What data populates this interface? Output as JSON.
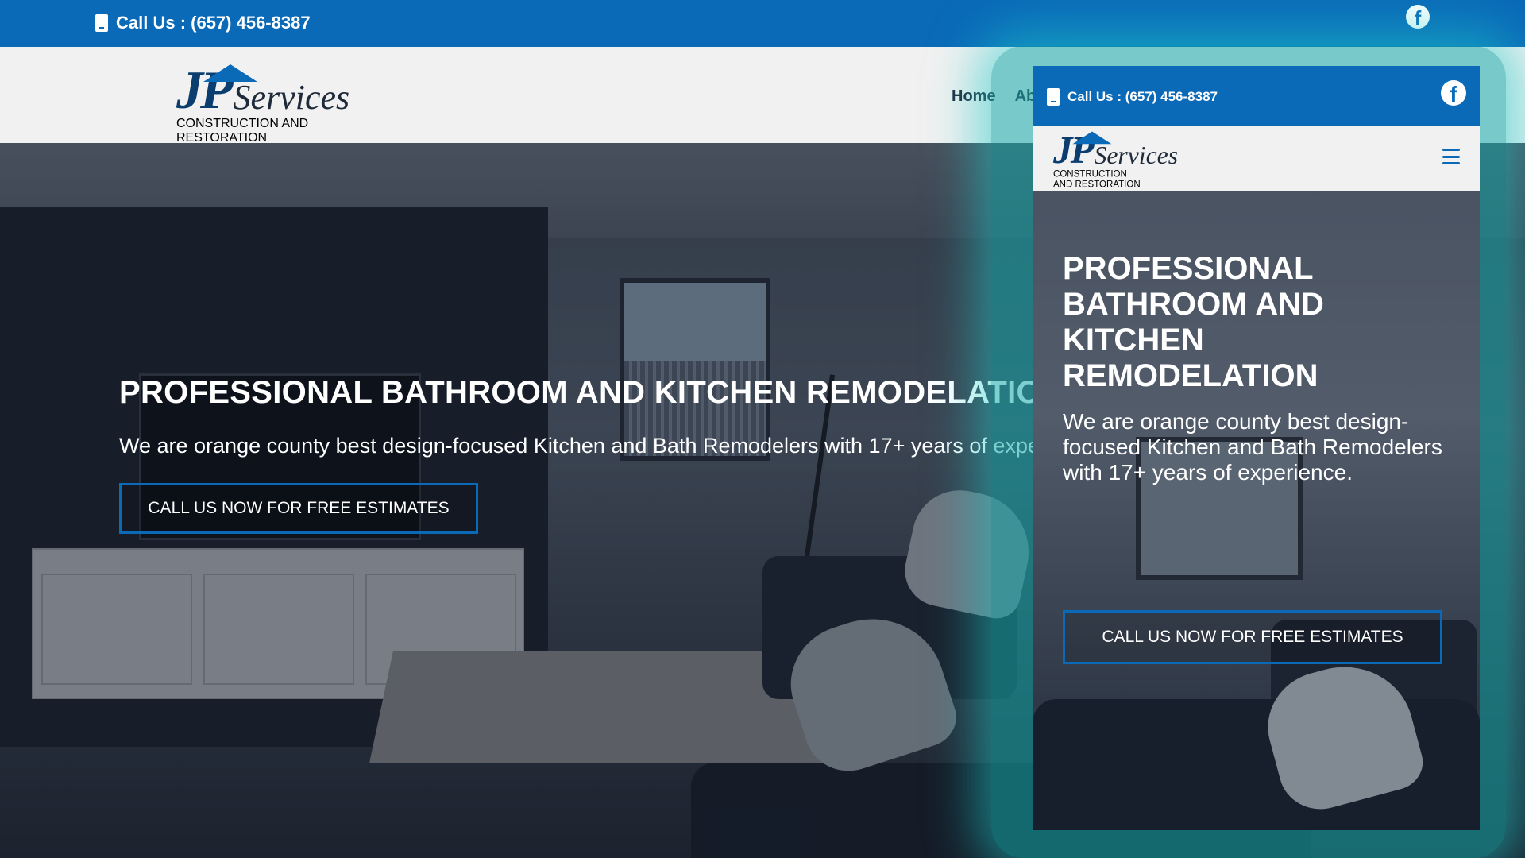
{
  "topbar": {
    "phone_label": "Call Us : (657) 456-8387",
    "phone_icon": "phone-icon",
    "social_icon": "facebook-icon"
  },
  "logo": {
    "initials": "JP",
    "name": "Services",
    "tagline": "CONSTRUCTION AND RESTORATION"
  },
  "nav": {
    "items": [
      "Home",
      "Ab"
    ]
  },
  "hero": {
    "title": "PROFESSIONAL BATHROOM AND KITCHEN REMODELATION",
    "subtitle": "We are orange county best design-focused Kitchen and Bath Remodelers with 17+ years of experience.",
    "cta_label": "CALL US NOW FOR FREE ESTIMATES"
  },
  "mobile": {
    "phone_label": "Call Us : (657) 456-8387",
    "menu_icon": "hamburger-menu-icon",
    "title": "PROFESSIONAL BATHROOM AND KITCHEN REMODELATION",
    "subtitle": "We are orange county best design-focused Kitchen and Bath Remodelers with 17+ years of experience.",
    "cta_label": "CALL US NOW FOR FREE ESTIMATES"
  },
  "colors": {
    "brand_blue": "#0a6ab8",
    "highlight_teal": "#1ec8c8"
  }
}
